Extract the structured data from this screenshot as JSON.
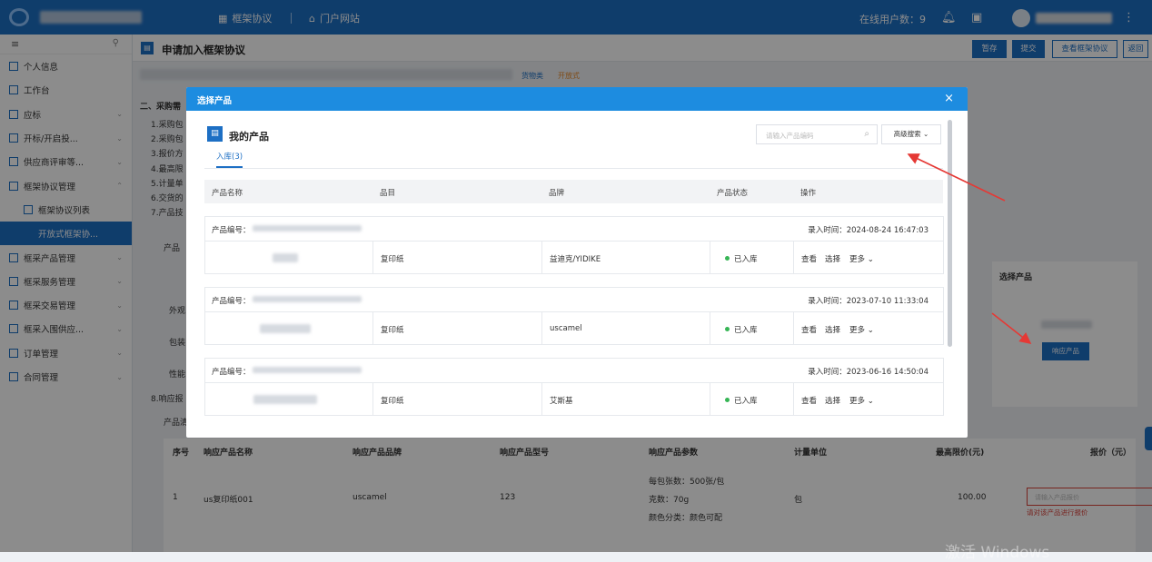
{
  "topbar": {
    "nav_framework": "框架协议",
    "nav_portal": "门户网站",
    "online_users": "在线用户数：9",
    "icons": [
      "grid-icon",
      "home-icon",
      "bell-icon",
      "calendar-icon",
      "user-icon",
      "more-icon"
    ]
  },
  "sidebar": {
    "items": [
      {
        "label": "个人信息",
        "icon": "person-icon"
      },
      {
        "label": "工作台",
        "icon": "desk-icon"
      },
      {
        "label": "应标",
        "icon": "bid-icon",
        "arrow": "⌄"
      },
      {
        "label": "开标/开启投...",
        "icon": "open-icon",
        "arrow": "⌄"
      },
      {
        "label": "供应商评审等...",
        "icon": "review-icon",
        "arrow": "⌄"
      },
      {
        "label": "框架协议管理",
        "icon": "framework-icon",
        "arrow": "⌃"
      },
      {
        "label": "框架协议列表",
        "icon": "list-icon",
        "sub": true
      },
      {
        "label": "开放式框架协...",
        "active": true
      },
      {
        "label": "框采产品管理",
        "icon": "product-icon",
        "arrow": "⌄"
      },
      {
        "label": "框采服务管理",
        "icon": "service-icon",
        "arrow": "⌄"
      },
      {
        "label": "框采交易管理",
        "icon": "trade-icon",
        "arrow": "⌄"
      },
      {
        "label": "框采入围供应...",
        "icon": "supplier-icon",
        "arrow": "⌄"
      },
      {
        "label": "订单管理",
        "icon": "order-icon",
        "arrow": "⌄"
      },
      {
        "label": "合同管理",
        "icon": "contract-icon",
        "arrow": "⌄"
      }
    ]
  },
  "header": {
    "title": "申请加入框架协议",
    "btn_save": "暂存",
    "btn_submit": "提交",
    "btn_view": "查看框架协议",
    "btn_back": "返回"
  },
  "bg": {
    "tag_goods": "货物类",
    "tag_open": "开放式",
    "section2": "二、采购需",
    "lines": [
      "1.采购包",
      "2.采购包",
      "3.报价方",
      "4.最高限",
      "5.计量单",
      "6.交货的",
      "7.产品技"
    ],
    "product": "产品",
    "outer": "外观",
    "pack": "包装",
    "perf": "性能",
    "line8": "8.响应报",
    "product_sub": "产品清",
    "select_product": "选择产品",
    "respond_product": "响应产品",
    "table_headers": [
      "序号",
      "响应产品名称",
      "响应产品品牌",
      "响应产品型号",
      "响应产品参数",
      "计量单位",
      "最高限价(元)",
      "报价（元）"
    ],
    "row": {
      "no": "1",
      "name": "us复印纸001",
      "brand": "uscamel",
      "model": "123",
      "param1": "每包张数：500张/包",
      "param2": "克数：70g",
      "param3": "颜色分类：颜色可配",
      "unit": "包",
      "max_price": "100.00",
      "price_placeholder": "请输入产品报价",
      "price_error": "请对该产品进行报价"
    }
  },
  "modal": {
    "title": "选择产品",
    "close": "×",
    "panel_title": "我的产品",
    "search_placeholder": "请输入产品编码",
    "adv_search": "高级搜索",
    "tab": "入库(3)",
    "columns": [
      "产品名称",
      "品目",
      "品牌",
      "产品状态",
      "操作"
    ],
    "products": [
      {
        "no_label": "产品编号：",
        "time": "录入时间：2024-08-24 16:47:03",
        "category": "复印纸",
        "brand": "益迪克/YIDIKE",
        "status": "已入库"
      },
      {
        "no_label": "产品编号：",
        "time": "录入时间：2023-07-10 11:33:04",
        "category": "复印纸",
        "brand": "uscamel",
        "status": "已入库"
      },
      {
        "no_label": "产品编号：",
        "time": "录入时间：2023-06-16 14:50:04",
        "category": "复印纸",
        "brand": "艾斯基",
        "status": "已入库"
      }
    ],
    "ops": {
      "view": "查看",
      "select": "选择",
      "more": "更多"
    }
  },
  "watermark": "激活 Windows"
}
